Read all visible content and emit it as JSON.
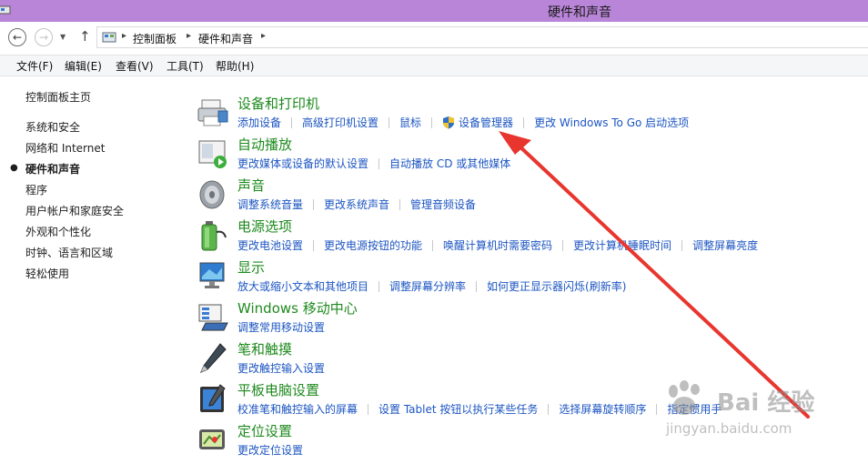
{
  "window": {
    "title": "硬件和声音"
  },
  "addressbar": {
    "back_icon": "back-arrow-icon",
    "forward_icon": "forward-arrow-icon",
    "breadcrumb": [
      "控制面板",
      "硬件和声音"
    ]
  },
  "menubar": {
    "items": [
      "文件(F)",
      "编辑(E)",
      "查看(V)",
      "工具(T)",
      "帮助(H)"
    ]
  },
  "sidebar": {
    "home": "控制面板主页",
    "items": [
      {
        "label": "系统和安全"
      },
      {
        "label": "网络和 Internet"
      },
      {
        "label": "硬件和声音",
        "current": true
      },
      {
        "label": "程序"
      },
      {
        "label": "用户帐户和家庭安全"
      },
      {
        "label": "外观和个性化"
      },
      {
        "label": "时钟、语言和区域"
      },
      {
        "label": "轻松使用"
      }
    ]
  },
  "categories": [
    {
      "title": "设备和打印机",
      "icon": "printer-icon",
      "links": [
        "添加设备",
        "高级打印机设置",
        "鼠标",
        "设备管理器",
        "更改 Windows To Go 启动选项"
      ]
    },
    {
      "title": "自动播放",
      "icon": "autoplay-icon",
      "links": [
        "更改媒体或设备的默认设置",
        "自动播放 CD 或其他媒体"
      ]
    },
    {
      "title": "声音",
      "icon": "speaker-icon",
      "links": [
        "调整系统音量",
        "更改系统声音",
        "管理音频设备"
      ]
    },
    {
      "title": "电源选项",
      "icon": "battery-icon",
      "links": [
        "更改电池设置",
        "更改电源按钮的功能",
        "唤醒计算机时需要密码",
        "更改计算机睡眠时间",
        "调整屏幕亮度"
      ]
    },
    {
      "title": "显示",
      "icon": "monitor-icon",
      "links": [
        "放大或缩小文本和其他项目",
        "调整屏幕分辨率",
        "如何更正显示器闪烁(刷新率)"
      ]
    },
    {
      "title": "Windows 移动中心",
      "icon": "mobility-center-icon",
      "links": [
        "调整常用移动设置"
      ]
    },
    {
      "title": "笔和触摸",
      "icon": "pen-icon",
      "links": [
        "更改触控输入设置"
      ]
    },
    {
      "title": "平板电脑设置",
      "icon": "tablet-icon",
      "links": [
        "校准笔和触控输入的屏幕",
        "设置 Tablet 按钮以执行某些任务",
        "选择屏幕旋转顺序",
        "指定惯用手"
      ]
    },
    {
      "title": "定位设置",
      "icon": "location-icon",
      "links": [
        "更改定位设置"
      ]
    }
  ],
  "watermark": {
    "text": "Bai 经验",
    "url": "jingyan.baidu.com"
  },
  "colors": {
    "titlebar": "#b985d8",
    "heading": "#1e8a1e",
    "link": "#1c55c2",
    "annotation_arrow": "#e8362f"
  }
}
